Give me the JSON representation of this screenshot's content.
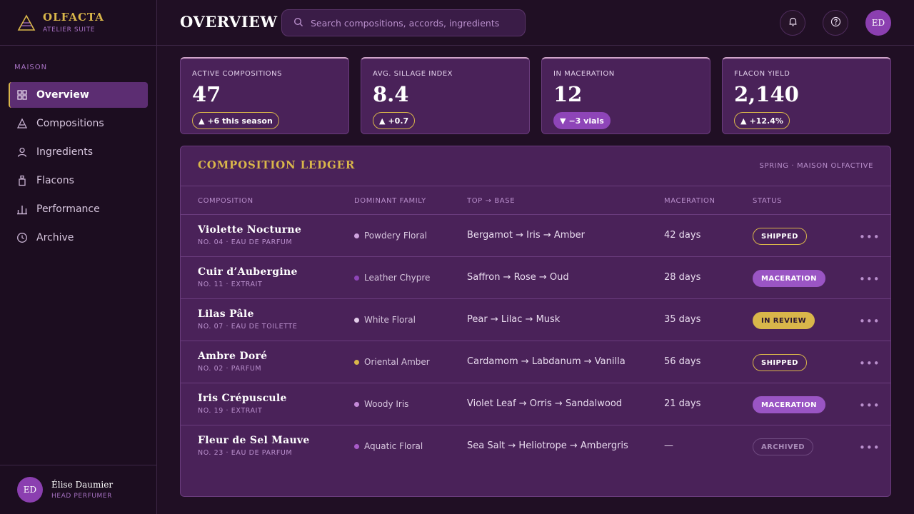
{
  "brand": {
    "name": "OLFACTA",
    "subtitle": "ATELIER SUITE"
  },
  "sidebar": {
    "section_label": "MAISON",
    "items": [
      {
        "label": "Overview",
        "icon": "grid-icon",
        "active": true
      },
      {
        "label": "Compositions",
        "icon": "triangle-icon",
        "active": false
      },
      {
        "label": "Ingredients",
        "icon": "user-icon",
        "active": false
      },
      {
        "label": "Flacons",
        "icon": "bottle-icon",
        "active": false
      },
      {
        "label": "Performance",
        "icon": "bars-icon",
        "active": false
      },
      {
        "label": "Archive",
        "icon": "clock-icon",
        "active": false
      }
    ],
    "user": {
      "initials": "ED",
      "name": "Élise Daumier",
      "role": "HEAD PERFUMER"
    }
  },
  "header": {
    "title": "OVERVIEW",
    "search_placeholder": "Search compositions, accords, ingredients",
    "avatar_initials": "ED"
  },
  "kpis": [
    {
      "label": "ACTIVE COMPOSITIONS",
      "value": "47",
      "change": "+6 this season",
      "direction": "up"
    },
    {
      "label": "AVG. SILLAGE INDEX",
      "value": "8.4",
      "change": "+0.7",
      "direction": "up"
    },
    {
      "label": "IN MACERATION",
      "value": "12",
      "change": "−3 vials",
      "direction": "down"
    },
    {
      "label": "FLACON YIELD",
      "value": "2,140",
      "change": "+12.4%",
      "direction": "up"
    }
  ],
  "ledger": {
    "title": "COMPOSITION LEDGER",
    "season": "SPRING · MAISON OLFACTIVE",
    "columns": [
      "COMPOSITION",
      "DOMINANT FAMILY",
      "TOP → BASE",
      "MACERATION",
      "STATUS"
    ],
    "rows": [
      {
        "name": "Violette Nocturne",
        "sub": "NO. 04 · EAU DE PARFUM",
        "family": "Powdery Floral",
        "dot": "#cfa3df",
        "notes": "Bergamot → Iris → Amber",
        "maceration": "42 days",
        "status": "SHIPPED",
        "status_style": "outline"
      },
      {
        "name": "Cuir d’Aubergine",
        "sub": "NO. 11 · EXTRAIT",
        "family": "Leather Chypre",
        "dot": "#8e45b8",
        "notes": "Saffron → Rose → Oud",
        "maceration": "28 days",
        "status": "MACERATION",
        "status_style": "fill"
      },
      {
        "name": "Lilas Pâle",
        "sub": "NO. 07 · EAU DE TOILETTE",
        "family": "White Floral",
        "dot": "#e3cdea",
        "notes": "Pear → Lilac → Musk",
        "maceration": "35 days",
        "status": "IN REVIEW",
        "status_style": "gold"
      },
      {
        "name": "Ambre Doré",
        "sub": "NO. 02 · PARFUM",
        "family": "Oriental Amber",
        "dot": "#d9b64a",
        "notes": "Cardamom → Labdanum → Vanilla",
        "maceration": "56 days",
        "status": "SHIPPED",
        "status_style": "outline"
      },
      {
        "name": "Iris Crépuscule",
        "sub": "NO. 19 · EXTRAIT",
        "family": "Woody Iris",
        "dot": "#c58ad9",
        "notes": "Violet Leaf → Orris → Sandalwood",
        "maceration": "21 days",
        "status": "MACERATION",
        "status_style": "fill"
      },
      {
        "name": "Fleur de Sel Mauve",
        "sub": "NO. 23 · EAU DE PARFUM",
        "family": "Aquatic Floral",
        "dot": "#a85bc9",
        "notes": "Sea Salt → Heliotrope → Ambergris",
        "maceration": "—",
        "status": "ARCHIVED",
        "status_style": "muted"
      }
    ]
  },
  "colors": {
    "accent_gold": "#d9b64a",
    "accent_purple": "#8e45b8",
    "panel": "#4a2259",
    "background": "#200f24"
  }
}
